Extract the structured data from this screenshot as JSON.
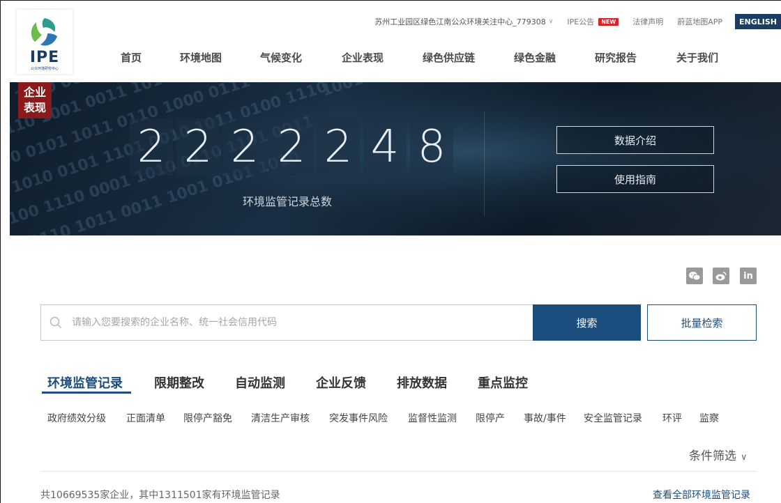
{
  "topbar": {
    "org": "苏州工业园区绿色江南公众环境关注中心_779308",
    "notice": "IPE公告",
    "new_badge": "NEW",
    "legal": "法律声明",
    "app": "蔚蓝地图APP",
    "lang": "ENGLISH"
  },
  "logo": {
    "text": "IPE",
    "sub": "公众环境研究中心"
  },
  "nav": [
    "首页",
    "环境地图",
    "气候变化",
    "企业表现",
    "绿色供应链",
    "绿色金融",
    "研究报告",
    "关于我们"
  ],
  "hero": {
    "tag": "企业\n表现",
    "tag_line1": "企业",
    "tag_line2": "表现",
    "digits": [
      "2",
      "2",
      "2",
      "2",
      "2",
      "4",
      "8"
    ],
    "caption": "环境监管记录总数",
    "btn_data_intro": "数据介绍",
    "btn_guide": "使用指南"
  },
  "social": {
    "wechat": "wechat-icon",
    "weibo": "weibo-icon",
    "linkedin": "in"
  },
  "search": {
    "placeholder": "请输入您要搜索的企业名称、统一社会信用代码",
    "button": "搜索",
    "batch": "批量检索"
  },
  "tabs": [
    "环境监管记录",
    "限期整改",
    "自动监测",
    "企业反馈",
    "排放数据",
    "重点监控"
  ],
  "subfilters": [
    "政府绩效分级",
    "正面清单",
    "限停产豁免",
    "清洁生产审核",
    "突发事件风险",
    "监督性监测",
    "限停产",
    "事故/事件",
    "安全监管记录",
    "环评",
    "监察"
  ],
  "filter_label": "条件筛选",
  "summary": "共10669535家企业，其中1311501家有环境监管记录",
  "view_all": "查看全部环境监管记录",
  "colors": {
    "primary": "#1b4d7e",
    "badge": "#d8232a",
    "tag": "#8b1a1a"
  }
}
